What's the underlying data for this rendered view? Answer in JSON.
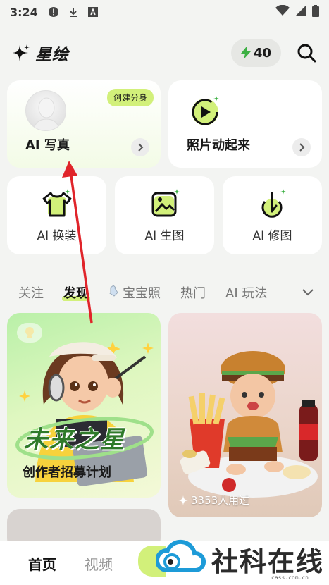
{
  "status_bar": {
    "time": "3:24"
  },
  "header": {
    "app_name": "星绘",
    "points": "40"
  },
  "cards": {
    "ai_photo": {
      "title": "AI 写真",
      "badge": "创建分身"
    },
    "animate": {
      "title": "照片动起来"
    }
  },
  "tools": [
    {
      "label": "AI 换装",
      "icon": "tshirt-icon"
    },
    {
      "label": "AI 生图",
      "icon": "image-gen-icon"
    },
    {
      "label": "AI 修图",
      "icon": "retouch-icon"
    }
  ],
  "tabs": [
    {
      "label": "关注",
      "active": false
    },
    {
      "label": "发现",
      "active": true
    },
    {
      "label": "宝宝照",
      "active": false,
      "icon": "bottle-icon"
    },
    {
      "label": "热门",
      "active": false
    },
    {
      "label": "AI 玩法",
      "active": false
    }
  ],
  "feed": {
    "left": {
      "banner": "未来之星",
      "caption": "创作者招募计划"
    },
    "right": {
      "usage": "3353人用过"
    }
  },
  "bottom_nav": [
    {
      "label": "首页",
      "active": true
    },
    {
      "label": "视频",
      "active": false
    }
  ],
  "watermark": {
    "text": "社科在线",
    "url": "cass.com.cn"
  },
  "colors": {
    "accent": "#d2f07a",
    "annotation": "#e0242a"
  }
}
